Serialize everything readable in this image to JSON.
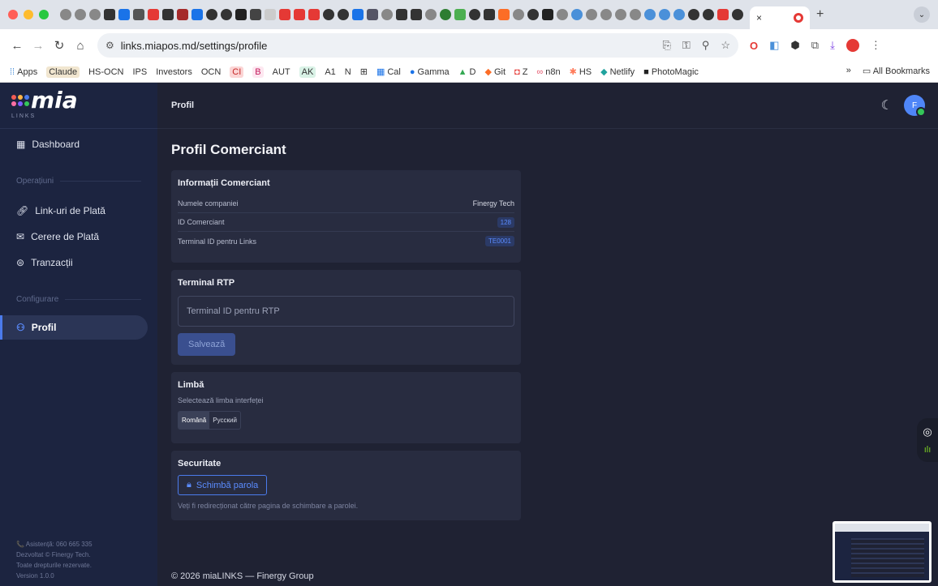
{
  "browser": {
    "active_tab_close": "×",
    "new_tab": "+",
    "url": "links.miapos.md/settings/profile",
    "bookmarks": [
      "Apps",
      "Claude",
      "HS-OCN",
      "IPS",
      "Investors",
      "OCN",
      "CI",
      "B",
      "AUT",
      "AK",
      "A1",
      "N",
      "Cal",
      "Gamma",
      "D",
      "Git",
      "Z",
      "n8n",
      "HS",
      "Netlify",
      "PhotoMagic"
    ],
    "bookmarks_more": "»",
    "all_bookmarks": "All Bookmarks"
  },
  "sidebar": {
    "logo": "mia",
    "logo_sub": "LINKS",
    "dashboard": "Dashboard",
    "section_operations": "Operațiuni",
    "items_operations": [
      "Link-uri de Plată",
      "Cerere de Plată",
      "Tranzacții"
    ],
    "section_config": "Configurare",
    "profile": "Profil",
    "footer": [
      "📞 Asistență: 060 665 335",
      "Dezvoltat © Finergy Tech.",
      "Toate drepturile rezervate.",
      "Version 1.0.0"
    ]
  },
  "topbar": {
    "breadcrumb": "Profil",
    "avatar_initial": "F"
  },
  "page": {
    "title": "Profil Comerciant"
  },
  "merchant": {
    "heading": "Informații Comerciant",
    "company_label": "Numele companiei",
    "company_value": "Finergy Tech",
    "id_label": "ID Comerciant",
    "id_value": "128",
    "terminal_label": "Terminal ID pentru Links",
    "terminal_value": "TE0001"
  },
  "rtp": {
    "heading": "Terminal RTP",
    "placeholder": "Terminal ID pentru RTP",
    "save": "Salvează"
  },
  "language": {
    "heading": "Limbă",
    "subtitle": "Selectează limba interfeței",
    "options": [
      "Română",
      "Русский"
    ]
  },
  "security": {
    "heading": "Securitate",
    "change_password": "Schimbă parola",
    "note": "Veți fi redirecționat către pagina de schimbare a parolei."
  },
  "footer": "© 2026 miaLINKS — Finergy Group",
  "colors": {
    "sidebar": "#1c2440",
    "main": "#1f2233",
    "card": "#282c40",
    "accent": "#4b7bec"
  }
}
